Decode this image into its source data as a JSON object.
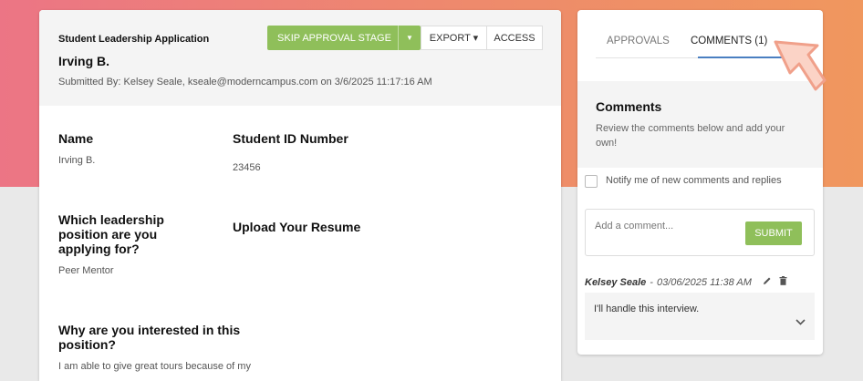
{
  "header": {
    "form_title": "Student Leadership Application",
    "applicant_name": "Irving B.",
    "submitted_by": "Submitted By: Kelsey Seale, kseale@moderncampus.com on 3/6/2025 11:17:16 AM"
  },
  "actions": {
    "skip_label": "SKIP APPROVAL STAGE",
    "skip_caret": "▼",
    "export_label": "EXPORT ▾",
    "access_label": "ACCESS"
  },
  "fields": {
    "name_label": "Name",
    "name_value": "Irving B.",
    "student_id_label": "Student ID Number",
    "student_id_value": "23456",
    "position_label_1": "Which leadership",
    "position_label_2": "position are you",
    "position_label_3": "applying for?",
    "position_value": "Peer Mentor",
    "resume_label": "Upload Your Resume",
    "why_label_1": "Why are you interested in this",
    "why_label_2": "position?",
    "why_value": "I am able to give great tours because of my"
  },
  "sidebar": {
    "tabs": [
      {
        "label": "APPROVALS"
      },
      {
        "label": "COMMENTS (1)"
      }
    ],
    "active_tab": "COMMENTS (1)",
    "comments_title": "Comments",
    "comments_desc": "Review the comments below and add your own!",
    "notify_label": "Notify me of new comments and replies",
    "notify_checked": false,
    "add_placeholder": "Add a comment...",
    "submit_label": "SUBMIT",
    "comment": {
      "author": "Kelsey Seale",
      "separator": "-",
      "timestamp": "03/06/2025 11:38 AM",
      "text": "I'll handle this interview.",
      "edit_icon": "pencil-icon",
      "delete_icon": "trash-icon",
      "expand_icon": "chevron-down-icon"
    }
  },
  "colors": {
    "accent_green": "#8fbf5a",
    "tab_underline": "#4a7fc1",
    "gradient_start": "#ec7585",
    "gradient_end": "#f0975e"
  }
}
